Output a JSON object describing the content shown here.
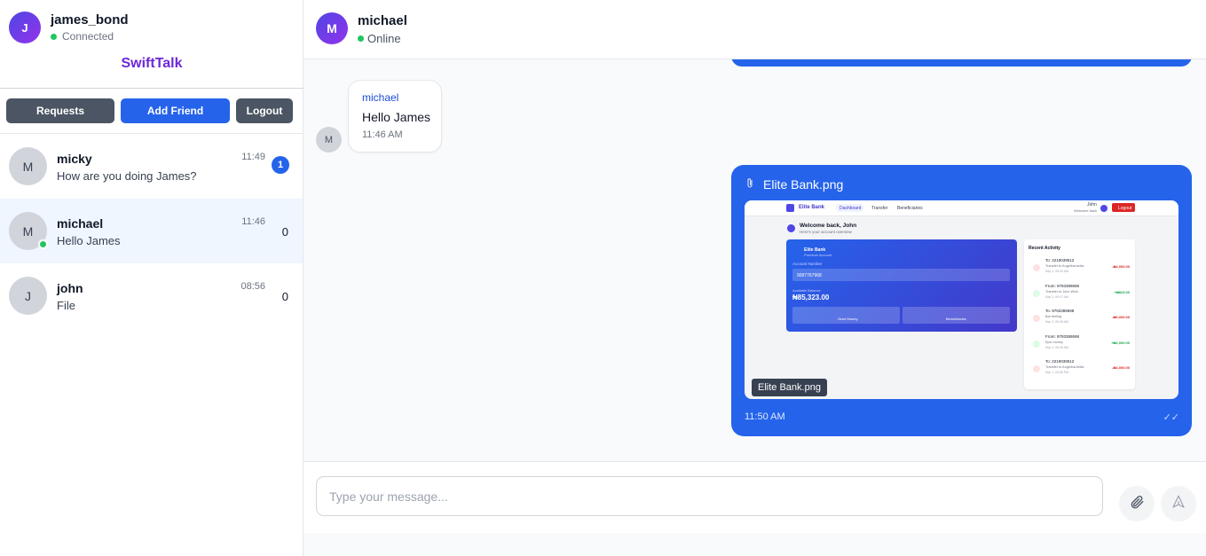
{
  "user": {
    "name": "james_bond",
    "initial": "J",
    "status": "Connected"
  },
  "app": {
    "brand": "SwiftTalk"
  },
  "buttons": {
    "requests": "Requests",
    "add_friend": "Add Friend",
    "logout": "Logout"
  },
  "chats": [
    {
      "initial": "M",
      "name": "micky",
      "last_message": "How are you doing James?",
      "time": "11:49",
      "unread": "1",
      "online": false,
      "active": false
    },
    {
      "initial": "M",
      "name": "michael",
      "last_message": "Hello James",
      "time": "11:46",
      "unread": "0",
      "online": true,
      "active": true
    },
    {
      "initial": "J",
      "name": "john",
      "last_message": "File",
      "time": "08:56",
      "unread": "0",
      "online": false,
      "active": false
    }
  ],
  "conversation": {
    "name": "michael",
    "initial": "M",
    "status": "Online",
    "incoming": {
      "avatar": "M",
      "sender": "michael",
      "text": "Hello James",
      "time": "11:46 AM"
    },
    "outgoing": {
      "file_name": "Elite Bank.png",
      "caption": "Elite Bank.png",
      "time": "11:50 AM",
      "check": "✓✓",
      "preview": {
        "brand": "Elite Bank",
        "nav": [
          "Dashboard",
          "Transfer",
          "Beneficiaries"
        ],
        "user_name": "John",
        "user_sub": "Welcome back",
        "user_initial": "J",
        "logout": "Logout",
        "welcome": "Welcome back, John",
        "welcome_sub": "Here's your account overview",
        "card_title": "Elite Bank",
        "card_sub": "Premium Account",
        "account_label": "Account Number",
        "account_number": "9097767968",
        "balance_label": "Available Balance",
        "balance": "₦85,323.00",
        "send_money": "Send Money",
        "beneficiaries": "Beneficiaries",
        "activity_title": "Recent Activity",
        "activity": [
          {
            "title": "To: 2219039512",
            "desc": "Transfer to Angelina Anita",
            "date": "Sep 2, 09:32 AM",
            "amount": "-₦4,000.00",
            "type": "debit"
          },
          {
            "title": "From: 9793389598",
            "desc": "Transfer to John Wick",
            "date": "Sep 2, 09:27 AM",
            "amount": "+₦823.00",
            "type": "credit"
          },
          {
            "title": "To: 9793389598",
            "desc": "Bar feeling",
            "date": "Sep 2, 09:26 AM",
            "amount": "-₦6,000.00",
            "type": "debit"
          },
          {
            "title": "From: 9793389598",
            "desc": "Epic money",
            "date": "Sep 2, 09:25 AM",
            "amount": "+₦2,000.00",
            "type": "credit"
          },
          {
            "title": "To: 2219039512",
            "desc": "Transfer to Angelina Anita",
            "date": "Sep 1, 03:56 PM",
            "amount": "-₦4,000.00",
            "type": "debit"
          }
        ]
      }
    }
  },
  "composer": {
    "placeholder": "Type your message..."
  },
  "icons": {
    "attach": "paperclip-icon",
    "send": "send-icon"
  },
  "colors": {
    "primary": "#2563eb",
    "brand": "#6d28d9",
    "online": "#22c55e",
    "debit": "#dc2626",
    "credit": "#16a34a"
  }
}
